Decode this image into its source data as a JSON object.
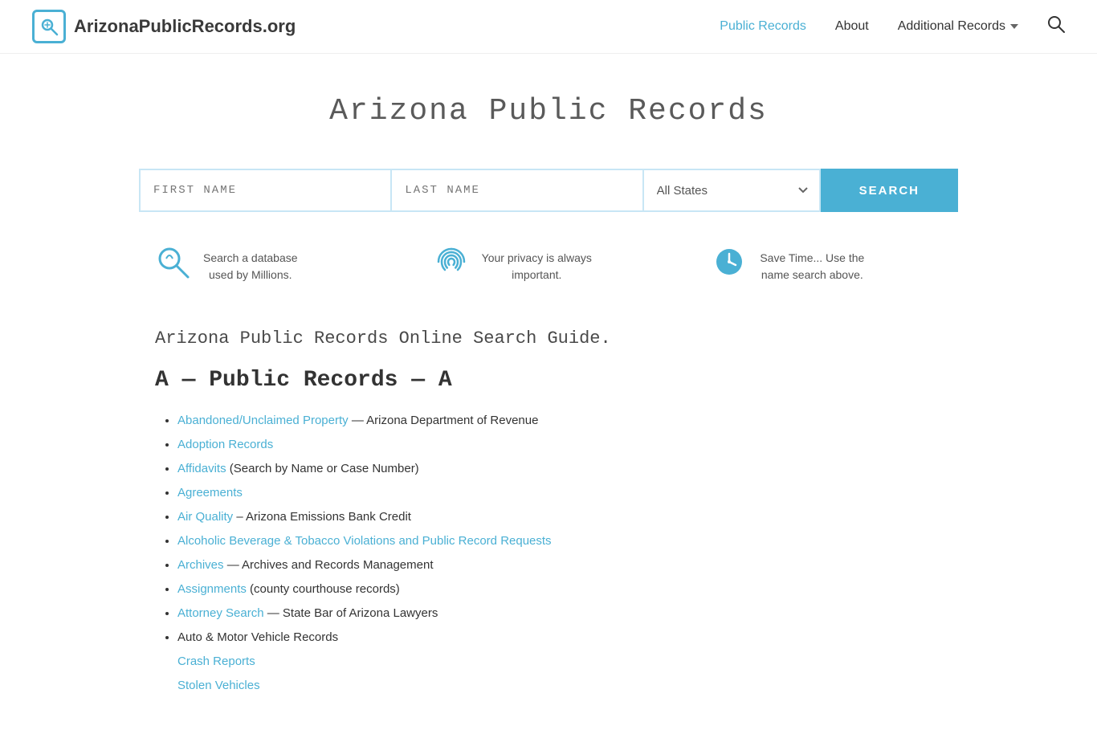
{
  "site": {
    "logo_text": "ArizonaPublicRecords.org",
    "title": "Arizona Public Records"
  },
  "nav": {
    "public_records": "Public Records",
    "about": "About",
    "additional_records": "Additional Records"
  },
  "search": {
    "first_name_placeholder": "FIRST NAME",
    "last_name_placeholder": "LAST NAME",
    "state_default": "All States",
    "button_label": "SEARCH"
  },
  "features": [
    {
      "text": "Search a database\nused by Millions."
    },
    {
      "text": "Your privacy is always\nimportant."
    },
    {
      "text": "Save Time... Use the\nname search above."
    }
  ],
  "guide": {
    "section_title": "Arizona Public Records Online Search Guide.",
    "alpha_title": "A — Public Records — A",
    "records": [
      {
        "link_text": "Abandoned/Unclaimed Property",
        "suffix": " — Arizona Department of Revenue"
      },
      {
        "link_text": "Adoption Records",
        "suffix": ""
      },
      {
        "link_text": "Affidavits",
        "suffix": " (Search by Name or Case Number)"
      },
      {
        "link_text": "Agreements",
        "suffix": ""
      },
      {
        "link_text": "Air Quality",
        "suffix": " – Arizona Emissions Bank Credit"
      },
      {
        "link_text": "Alcoholic Beverage & Tobacco Violations and Public Record Requests",
        "suffix": ""
      },
      {
        "link_text": "Archives",
        "suffix": " — Archives and Records Management"
      },
      {
        "link_text": "Assignments",
        "suffix": " (county courthouse records)"
      },
      {
        "link_text": "Attorney Search",
        "suffix": " — State Bar of Arizona Lawyers"
      },
      {
        "plain": "Auto & Motor Vehicle Records",
        "sub": [
          "Crash Reports",
          "Stolen Vehicles"
        ]
      }
    ]
  }
}
